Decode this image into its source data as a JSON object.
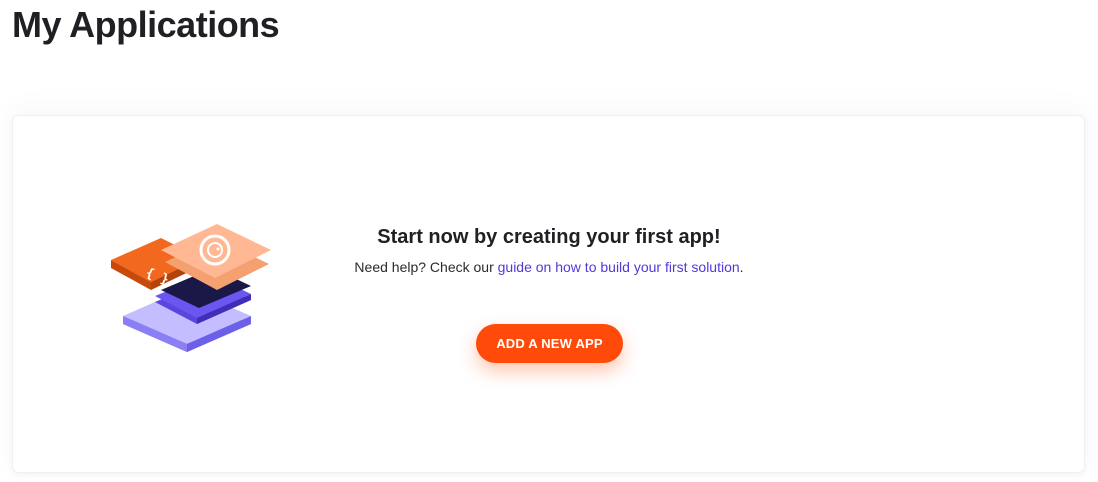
{
  "page": {
    "title": "My Applications"
  },
  "empty_state": {
    "headline": "Start now by creating your first app!",
    "help_prefix": "Need help? Check our ",
    "help_link": "guide on how to build your first solution",
    "help_suffix": ".",
    "illustration_icon": "stacked-app-layers-icon"
  },
  "actions": {
    "add_app_label": "ADD A NEW APP"
  },
  "colors": {
    "accent": "#ff4a0a",
    "link": "#4f3bd6",
    "layer_orange": "#e85a12",
    "layer_peach": "#ffb48a",
    "layer_navy": "#1a1846",
    "layer_purple": "#5a45e0",
    "layer_lavender": "#b9b2ff"
  }
}
